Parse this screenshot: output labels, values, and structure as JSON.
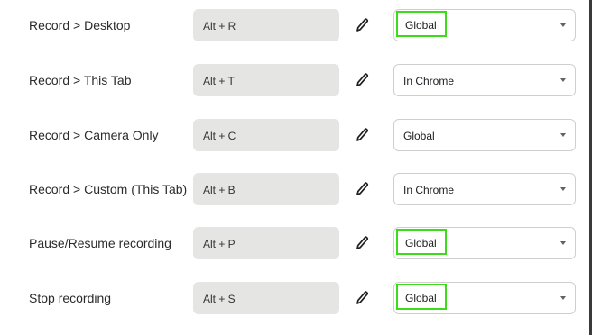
{
  "shortcuts": [
    {
      "label": "Record > Desktop",
      "keys": "Alt + R",
      "scope": "Global",
      "scope_highlighted": true
    },
    {
      "label": "Record > This Tab",
      "keys": "Alt + T",
      "scope": "In Chrome",
      "scope_highlighted": false
    },
    {
      "label": "Record > Camera Only",
      "keys": "Alt + C",
      "scope": "Global",
      "scope_highlighted": false
    },
    {
      "label": "Record > Custom (This Tab)",
      "keys": "Alt + B",
      "scope": "In Chrome",
      "scope_highlighted": false
    },
    {
      "label": "Pause/Resume recording",
      "keys": "Alt + P",
      "scope": "Global",
      "scope_highlighted": true
    },
    {
      "label": "Stop recording",
      "keys": "Alt + S",
      "scope": "Global",
      "scope_highlighted": true
    }
  ],
  "icons": {
    "edit": "pencil-icon",
    "dropdown": "chevron-down-icon"
  },
  "colors": {
    "shortcut_bg": "#e5e5e3",
    "highlight": "#3ddc1a",
    "select_border": "#cfcfcf"
  }
}
